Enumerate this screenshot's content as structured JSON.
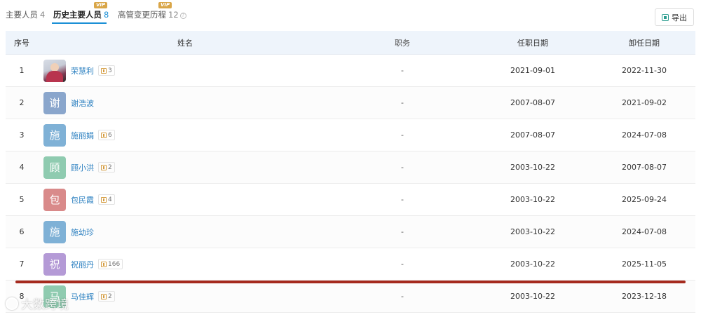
{
  "tabs": [
    {
      "label": "主要人员",
      "count": "4",
      "vip": ""
    },
    {
      "label": "历史主要人员",
      "count": "8",
      "vip": "VIP"
    },
    {
      "label": "高管变更历程",
      "count": "12",
      "vip": "VIP"
    }
  ],
  "toolbar": {
    "export_label": "导出"
  },
  "columns": {
    "index": "序号",
    "name": "姓名",
    "position": "职务",
    "start": "任职日期",
    "end": "卸任日期"
  },
  "rows": [
    {
      "index": "1",
      "avatar": "",
      "avatar_color": "",
      "name": "荣慧利",
      "badge": "3",
      "position": "-",
      "start": "2021-09-01",
      "end": "2022-11-30"
    },
    {
      "index": "2",
      "avatar": "谢",
      "avatar_color": "#8aa6cc",
      "name": "谢浩波",
      "badge": "",
      "position": "-",
      "start": "2007-08-07",
      "end": "2021-09-02"
    },
    {
      "index": "3",
      "avatar": "施",
      "avatar_color": "#7fb1d6",
      "name": "施丽娟",
      "badge": "6",
      "position": "-",
      "start": "2007-08-07",
      "end": "2024-07-08"
    },
    {
      "index": "4",
      "avatar": "顾",
      "avatar_color": "#8fcbb0",
      "name": "顾小洪",
      "badge": "2",
      "position": "-",
      "start": "2003-10-22",
      "end": "2007-08-07"
    },
    {
      "index": "5",
      "avatar": "包",
      "avatar_color": "#d98a8a",
      "name": "包民霞",
      "badge": "4",
      "position": "-",
      "start": "2003-10-22",
      "end": "2025-09-24"
    },
    {
      "index": "6",
      "avatar": "施",
      "avatar_color": "#7fb1d6",
      "name": "施幼珍",
      "badge": "",
      "position": "-",
      "start": "2003-10-22",
      "end": "2024-07-08"
    },
    {
      "index": "7",
      "avatar": "祝",
      "avatar_color": "#b49ad6",
      "name": "祝丽丹",
      "badge": "166",
      "position": "-",
      "start": "2003-10-22",
      "end": "2025-11-05"
    },
    {
      "index": "8",
      "avatar": "马",
      "avatar_color": "#8fcbb0",
      "name": "马佳辉",
      "badge": "2",
      "position": "-",
      "start": "2003-10-22",
      "end": "2023-12-18"
    }
  ],
  "watermark": {
    "text": "大数跨境"
  }
}
